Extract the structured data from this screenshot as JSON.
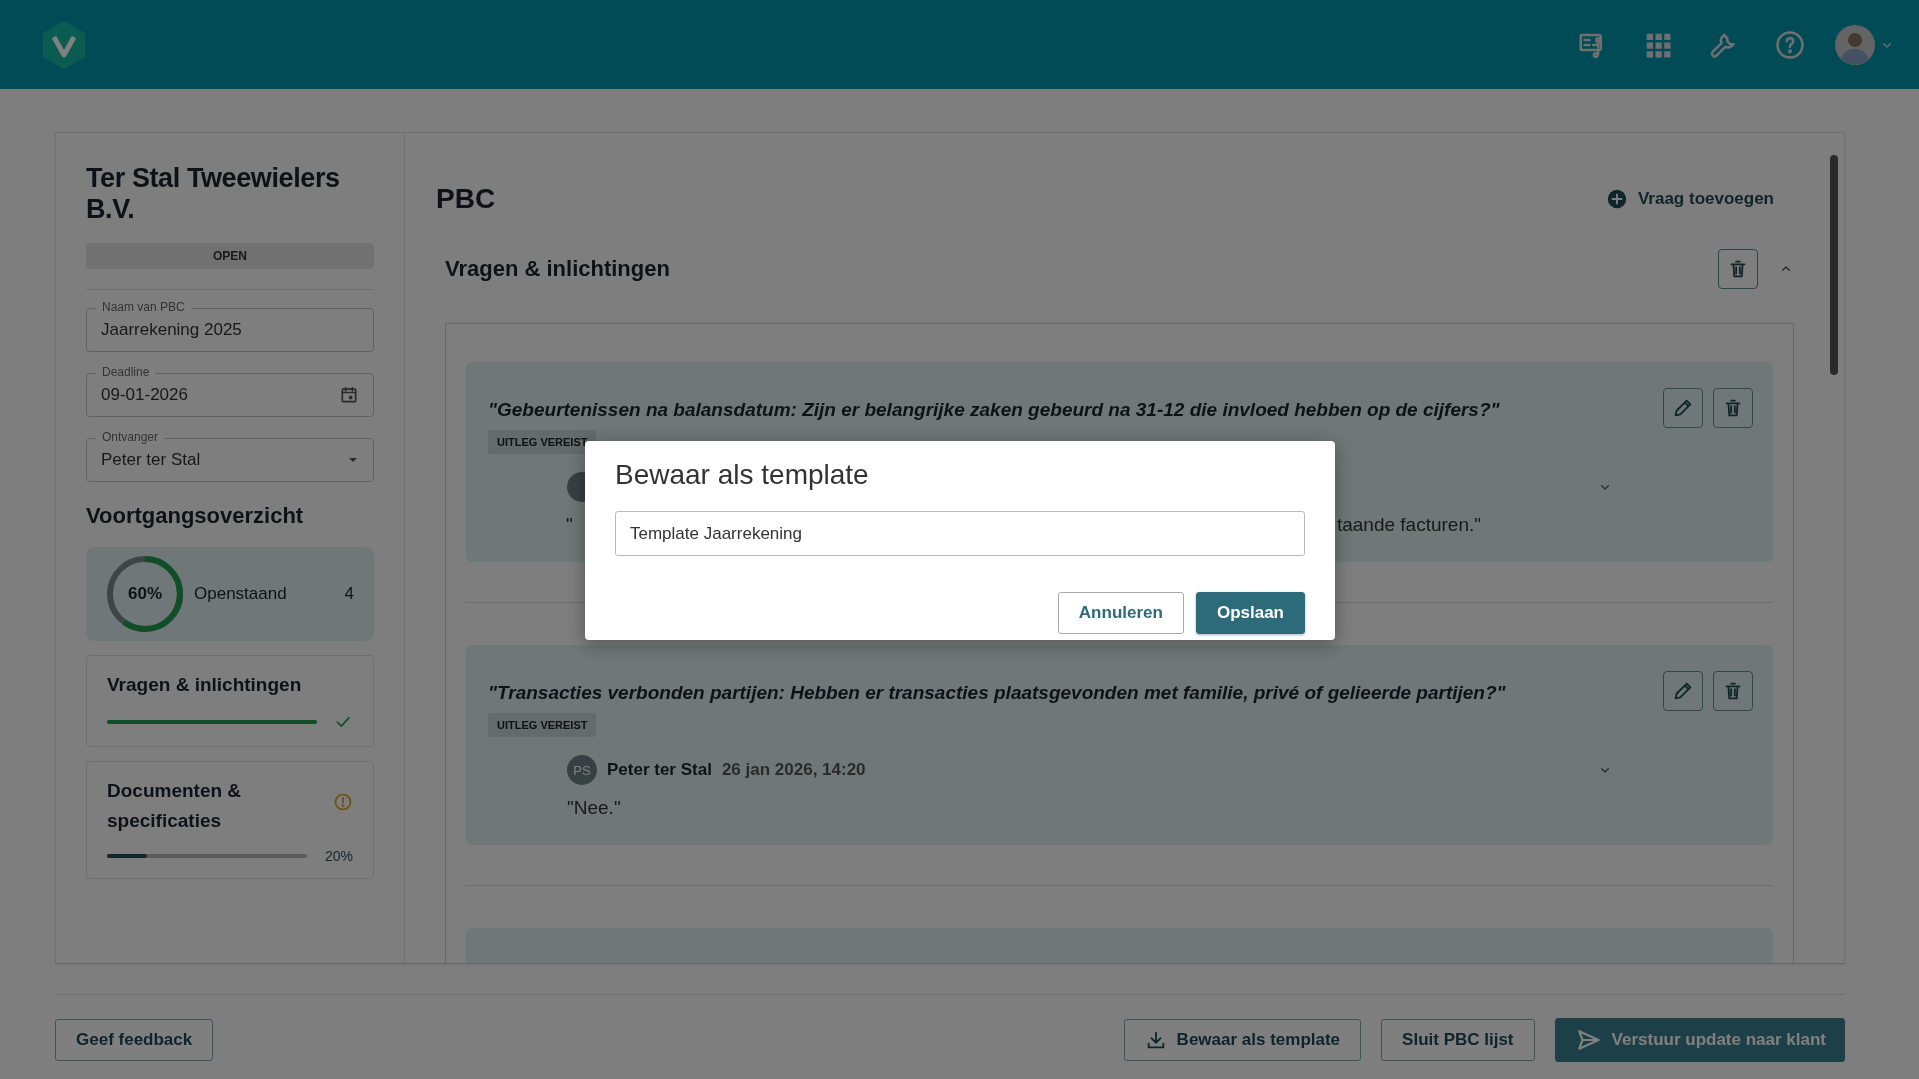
{
  "company": {
    "name": "Ter Stal Tweewielers B.V.",
    "status": "OPEN"
  },
  "fields": [
    {
      "kind": "text",
      "label": "Naam van PBC",
      "value": "Jaarrekening 2025"
    },
    {
      "kind": "date",
      "label": "Deadline",
      "value": "09-01-2026"
    },
    {
      "kind": "select",
      "label": "Ontvanger",
      "value": "Peter ter Stal"
    }
  ],
  "progress": {
    "title": "Voortgangsoverzicht",
    "percent": "60%",
    "level": 0.6,
    "label": "Openstaand",
    "count": "4",
    "sections": [
      {
        "title": "Vragen & inlichtingen",
        "level": 1,
        "complete": true
      },
      {
        "title": "Documenten & specificaties",
        "level": 0.2,
        "complete": false,
        "reading": "20%"
      }
    ]
  },
  "main": {
    "title": "PBC",
    "add_button": "Vraag toevoegen",
    "section": {
      "title": "Vragen & inlichtingen",
      "expanded": true
    },
    "questions": [
      {
        "kind": "question",
        "text": "\"Gebeurtenissen na balansdatum: Zijn er belangrijke zaken gebeurd na 31-12 die invloed hebben op de cijfers?\"",
        "tag": "UITLEG VEREIST",
        "answer": {
          "text_start": "\"",
          "text_end": "taande facturen.\""
        }
      },
      {
        "kind": "question",
        "text": "\"Transacties verbonden partijen: Hebben er transacties plaatsgevonden met familie, privé of gelieerde partijen?\"",
        "tag": "UITLEG VEREIST",
        "answer": {
          "initials": "PS",
          "author": "Peter ter Stal",
          "time": "26 jan 2026, 14:20",
          "text": "\"Nee.\""
        }
      },
      {
        "kind": "cut-off"
      }
    ]
  },
  "footer": {
    "feedback": "Geef feedback",
    "buttons": [
      {
        "kind": "download",
        "label": "Bewaar als template"
      },
      {
        "kind": "plain",
        "label": "Sluit PBC lijst"
      },
      {
        "kind": "send",
        "label": "Verstuur update naar klant"
      }
    ]
  },
  "dialog": {
    "title": "Bewaar als template",
    "value": "Template Jaarrekening",
    "buttons": [
      {
        "kind": "secondary",
        "label": "Annuleren"
      },
      {
        "kind": "primary",
        "label": "Opslaan"
      }
    ]
  }
}
